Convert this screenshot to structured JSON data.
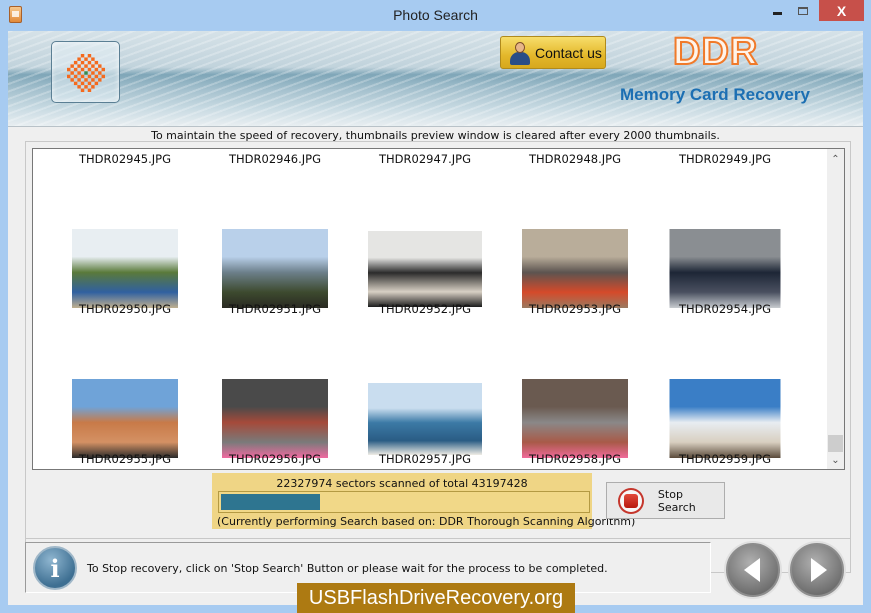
{
  "window": {
    "title": "Photo Search",
    "controls": {
      "minimize": "minimize",
      "maximize": "maximize",
      "close": "X"
    }
  },
  "header": {
    "contact_label": "Contact us",
    "brand": "DDR",
    "product": "Memory Card Recovery"
  },
  "notice": "To maintain the speed of recovery, thumbnails preview window is cleared after every 2000 thumbnails.",
  "thumbnails": [
    {
      "name": "THDR02945.JPG",
      "has_image": false
    },
    {
      "name": "THDR02946.JPG",
      "has_image": false
    },
    {
      "name": "THDR02947.JPG",
      "has_image": false
    },
    {
      "name": "THDR02948.JPG",
      "has_image": false
    },
    {
      "name": "THDR02949.JPG",
      "has_image": false
    },
    {
      "name": "THDR02950.JPG",
      "has_image": true,
      "subject": "farmers market stall",
      "colors": [
        "#e8eef2",
        "#5a7a3a",
        "#3060a0",
        "#c0b090"
      ]
    },
    {
      "name": "THDR02951.JPG",
      "has_image": true,
      "subject": "lake shore with trees",
      "colors": [
        "#b9d0ea",
        "#6c7f8a",
        "#3d4a2f",
        "#2a2a22"
      ]
    },
    {
      "name": "THDR02952.JPG",
      "has_image": true,
      "subject": "woman reclining on sofa",
      "colors": [
        "#e5e5e3",
        "#2b2b2b",
        "#d8d0c4",
        "#1c1c1c"
      ]
    },
    {
      "name": "THDR02953.JPG",
      "has_image": true,
      "subject": "atrium lobby",
      "colors": [
        "#b9ad9a",
        "#5c5450",
        "#d54a2a",
        "#9a7a60"
      ]
    },
    {
      "name": "THDR02954.JPG",
      "has_image": true,
      "subject": "group photo on steps",
      "colors": [
        "#8a8e92",
        "#1d2636",
        "#4a5060",
        "#c8ccd0"
      ]
    },
    {
      "name": "THDR02955.JPG",
      "has_image": true,
      "subject": "group in desert",
      "colors": [
        "#6fa3d8",
        "#c87a48",
        "#d49164",
        "#2a2a2a"
      ]
    },
    {
      "name": "THDR02956.JPG",
      "has_image": true,
      "subject": "girl in pink shirt",
      "colors": [
        "#4a4a4a",
        "#a54a3a",
        "#7a7a7a",
        "#f06aa0"
      ]
    },
    {
      "name": "THDR02957.JPG",
      "has_image": true,
      "subject": "paddle boarder at sea",
      "colors": [
        "#c9ddef",
        "#3c7aa6",
        "#2a5c84",
        "#f0ede6"
      ]
    },
    {
      "name": "THDR02958.JPG",
      "has_image": true,
      "subject": "children playing in yard",
      "colors": [
        "#6a5a50",
        "#8a8888",
        "#a85a48",
        "#f06a9a"
      ]
    },
    {
      "name": "THDR02959.JPG",
      "has_image": true,
      "subject": "beach with clouds",
      "colors": [
        "#3a7ec6",
        "#e8edf2",
        "#d8cfc0",
        "#5a4a3a"
      ]
    }
  ],
  "progress": {
    "text": "22327974 sectors scanned of total 43197428",
    "sectors_scanned": 22327974,
    "sectors_total": 43197428,
    "bar_fill_fraction": 0.27,
    "algorithm_text": "(Currently performing Search based on:  DDR Thorough Scanning Algorithm)"
  },
  "stop_button": {
    "label": "Stop Search"
  },
  "status": {
    "message": "To Stop recovery, click on 'Stop Search' Button or please wait for the process to be completed."
  },
  "nav": {
    "prev": "previous",
    "next": "next"
  },
  "watermark": "USBFlashDriveRecovery.org",
  "scrollbar": {
    "up": "^",
    "down": "v"
  },
  "colors": {
    "titlebar": "#a7cbf1",
    "close": "#c7504a",
    "progress_panel": "#efd585",
    "progress_fill": "#2e7590",
    "product_text": "#1c6fb3",
    "brand_outline": "#f07a2a",
    "watermark_bg": "#ad7a12"
  }
}
